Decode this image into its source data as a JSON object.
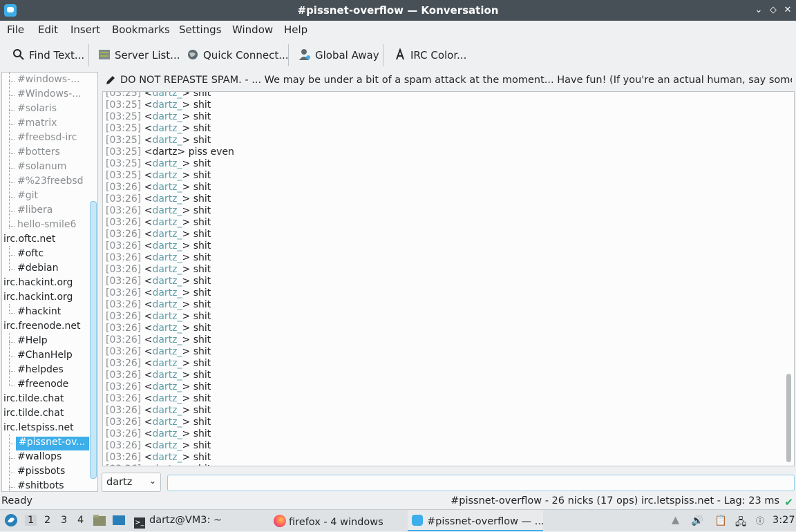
{
  "window": {
    "title": "#pissnet-overflow — Konversation"
  },
  "window_controls": {
    "minimize": "⌄",
    "maximize": "◇",
    "close": "✕"
  },
  "menu": [
    "File",
    "Edit",
    "Insert",
    "Bookmarks",
    "Settings",
    "Window",
    "Help"
  ],
  "toolbar": {
    "find": "Find Text...",
    "server_list": "Server List...",
    "quick_connect": "Quick Connect...",
    "global_away": "Global Away",
    "irc_color": "IRC Color..."
  },
  "sidebar": {
    "items": [
      {
        "label": "#windows-...",
        "dim": true,
        "child": true
      },
      {
        "label": "#Windows-...",
        "dim": true,
        "child": true
      },
      {
        "label": "#solaris",
        "dim": true,
        "child": true
      },
      {
        "label": "#matrix",
        "dim": true,
        "child": true
      },
      {
        "label": "#freebsd-irc",
        "dim": true,
        "child": true
      },
      {
        "label": "#botters",
        "dim": true,
        "child": true
      },
      {
        "label": "#solanum",
        "dim": true,
        "child": true
      },
      {
        "label": "#%23freebsd",
        "dim": true,
        "child": true
      },
      {
        "label": "#git",
        "dim": true,
        "child": true
      },
      {
        "label": "#libera",
        "dim": true,
        "child": true
      },
      {
        "label": "hello-smile6",
        "dim": true,
        "child": true
      },
      {
        "label": "irc.oftc.net",
        "dim": false,
        "child": false
      },
      {
        "label": "#oftc",
        "dim": false,
        "child": true
      },
      {
        "label": "#debian",
        "dim": false,
        "child": true
      },
      {
        "label": "irc.hackint.org",
        "dim": false,
        "child": false
      },
      {
        "label": "irc.hackint.org",
        "dim": false,
        "child": false
      },
      {
        "label": "#hackint",
        "dim": false,
        "child": true
      },
      {
        "label": "irc.freenode.net",
        "dim": false,
        "child": false
      },
      {
        "label": "#Help",
        "dim": false,
        "child": true
      },
      {
        "label": "#ChanHelp",
        "dim": false,
        "child": true
      },
      {
        "label": "#helpdes",
        "dim": false,
        "child": true
      },
      {
        "label": "#freenode",
        "dim": false,
        "child": true
      },
      {
        "label": "irc.tilde.chat",
        "dim": false,
        "child": false
      },
      {
        "label": "irc.tilde.chat",
        "dim": false,
        "child": false
      },
      {
        "label": "irc.letspiss.net",
        "dim": false,
        "child": false
      },
      {
        "label": "#pissnet-ov...",
        "dim": false,
        "child": true,
        "selected": true
      },
      {
        "label": "#wallops",
        "dim": false,
        "child": true
      },
      {
        "label": "#pissbots",
        "dim": false,
        "child": true
      },
      {
        "label": "#shitbots",
        "dim": false,
        "child": true
      }
    ]
  },
  "topic": "DO NOT REPASTE SPAM. - ... We may be under a bit of a spam attack at the moment... Have fun! (If you're an actual human, say something to ...",
  "messages": [
    {
      "time": "[03:25]",
      "nick": "dartz_",
      "text": "shit"
    },
    {
      "time": "[03:25]",
      "nick": "dartz_",
      "text": "shit"
    },
    {
      "time": "[03:25]",
      "nick": "dartz_",
      "text": "shit"
    },
    {
      "time": "[03:25]",
      "nick": "dartz_",
      "text": "shit"
    },
    {
      "time": "[03:25]",
      "nick": "dartz_",
      "text": "shit"
    },
    {
      "time": "[03:25]",
      "nick": "dartz",
      "text": "piss even",
      "own": true
    },
    {
      "time": "[03:25]",
      "nick": "dartz_",
      "text": "shit"
    },
    {
      "time": "[03:25]",
      "nick": "dartz_",
      "text": "shit"
    },
    {
      "time": "[03:26]",
      "nick": "dartz_",
      "text": "shit"
    },
    {
      "time": "[03:26]",
      "nick": "dartz_",
      "text": "shit"
    },
    {
      "time": "[03:26]",
      "nick": "dartz_",
      "text": "shit"
    },
    {
      "time": "[03:26]",
      "nick": "dartz_",
      "text": "shit"
    },
    {
      "time": "[03:26]",
      "nick": "dartz_",
      "text": "shit"
    },
    {
      "time": "[03:26]",
      "nick": "dartz_",
      "text": "shit"
    },
    {
      "time": "[03:26]",
      "nick": "dartz_",
      "text": "shit"
    },
    {
      "time": "[03:26]",
      "nick": "dartz_",
      "text": "shit"
    },
    {
      "time": "[03:26]",
      "nick": "dartz_",
      "text": "shit"
    },
    {
      "time": "[03:26]",
      "nick": "dartz_",
      "text": "shit"
    },
    {
      "time": "[03:26]",
      "nick": "dartz_",
      "text": "shit"
    },
    {
      "time": "[03:26]",
      "nick": "dartz_",
      "text": "shit"
    },
    {
      "time": "[03:26]",
      "nick": "dartz_",
      "text": "shit"
    },
    {
      "time": "[03:26]",
      "nick": "dartz_",
      "text": "shit"
    },
    {
      "time": "[03:26]",
      "nick": "dartz_",
      "text": "shit"
    },
    {
      "time": "[03:26]",
      "nick": "dartz_",
      "text": "shit"
    },
    {
      "time": "[03:26]",
      "nick": "dartz_",
      "text": "shit"
    },
    {
      "time": "[03:26]",
      "nick": "dartz_",
      "text": "shit"
    },
    {
      "time": "[03:26]",
      "nick": "dartz_",
      "text": "shit"
    },
    {
      "time": "[03:26]",
      "nick": "dartz_",
      "text": "shit"
    },
    {
      "time": "[03:26]",
      "nick": "dartz_",
      "text": "shit"
    },
    {
      "time": "[03:26]",
      "nick": "dartz_",
      "text": "shit"
    },
    {
      "time": "[03:26]",
      "nick": "dartz_",
      "text": "shit"
    },
    {
      "time": "[03:26]",
      "nick": "dartz_",
      "text": "shit"
    },
    {
      "time": "[03:26]",
      "nick": "dartz_",
      "text": "shit"
    }
  ],
  "input": {
    "nick": "dartz",
    "value": ""
  },
  "status": {
    "left": "Ready",
    "right": "#pissnet-overflow - 26 nicks (17 ops)  irc.letspiss.net - Lag: 23 ms"
  },
  "taskbar": {
    "desktops": [
      "1",
      "2",
      "3",
      "4"
    ],
    "tasks": [
      "dartz@VM3: ~",
      "firefox - 4 windows",
      "#pissnet-overflow — ..."
    ],
    "clock": "3:27"
  },
  "colors": {
    "accent": "#3daee9",
    "titlebar": "#475057",
    "nick": "#5e9fa8",
    "timestamp": "#8a8e91"
  }
}
